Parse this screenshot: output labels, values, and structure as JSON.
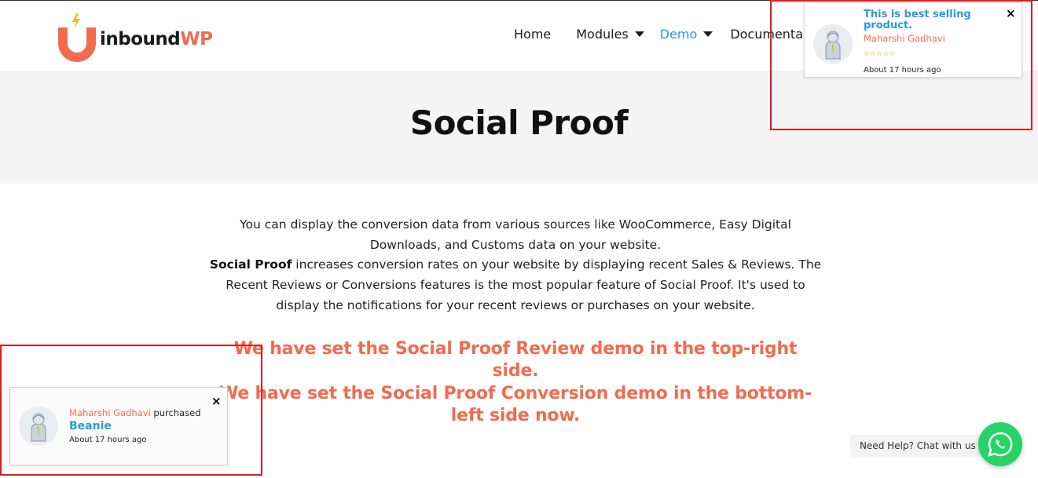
{
  "brand": {
    "name_part1": "inbound",
    "name_part2": "WP"
  },
  "nav": {
    "items": [
      {
        "label": "Home",
        "has_dropdown": false
      },
      {
        "label": "Modules",
        "has_dropdown": true
      },
      {
        "label": "Demo",
        "has_dropdown": true,
        "active": true
      },
      {
        "label": "Documenta",
        "has_dropdown": false
      }
    ]
  },
  "hero": {
    "title": "Social Proof"
  },
  "intro": {
    "line1": "You can display the conversion data from various sources like WooCommerce, Easy Digital Downloads, and Customs data on your website.",
    "bold": "Social Proof",
    "line2": " increases conversion rates on your website by displaying recent Sales & Reviews. The Recent Reviews or Conversions features is the most popular feature of Social Proof. It's used to display the notifications for your recent reviews or purchases on your website."
  },
  "notes": {
    "review_demo": "We have set the Social Proof Review demo in the top-right side.",
    "conversion_demo": "We have set the Social Proof Conversion demo in the bottom-left side now."
  },
  "review_popup": {
    "title": "This is best selling product.",
    "name": "Maharshi Gadhavi",
    "stars": "☆☆☆☆☆",
    "time": "About 17 hours ago",
    "close": "×"
  },
  "conversion_popup": {
    "name": "Maharshi Gadhavi",
    "action": " purchased",
    "product": "Beanie",
    "time": "About 17 hours ago",
    "close": "×"
  },
  "chat": {
    "label": "Need Help? Chat with us"
  },
  "colors": {
    "accent_orange": "#f26b4f",
    "accent_blue": "#2a9bd1",
    "annotation_red": "#e11b1b",
    "whatsapp_green": "#25d366"
  }
}
